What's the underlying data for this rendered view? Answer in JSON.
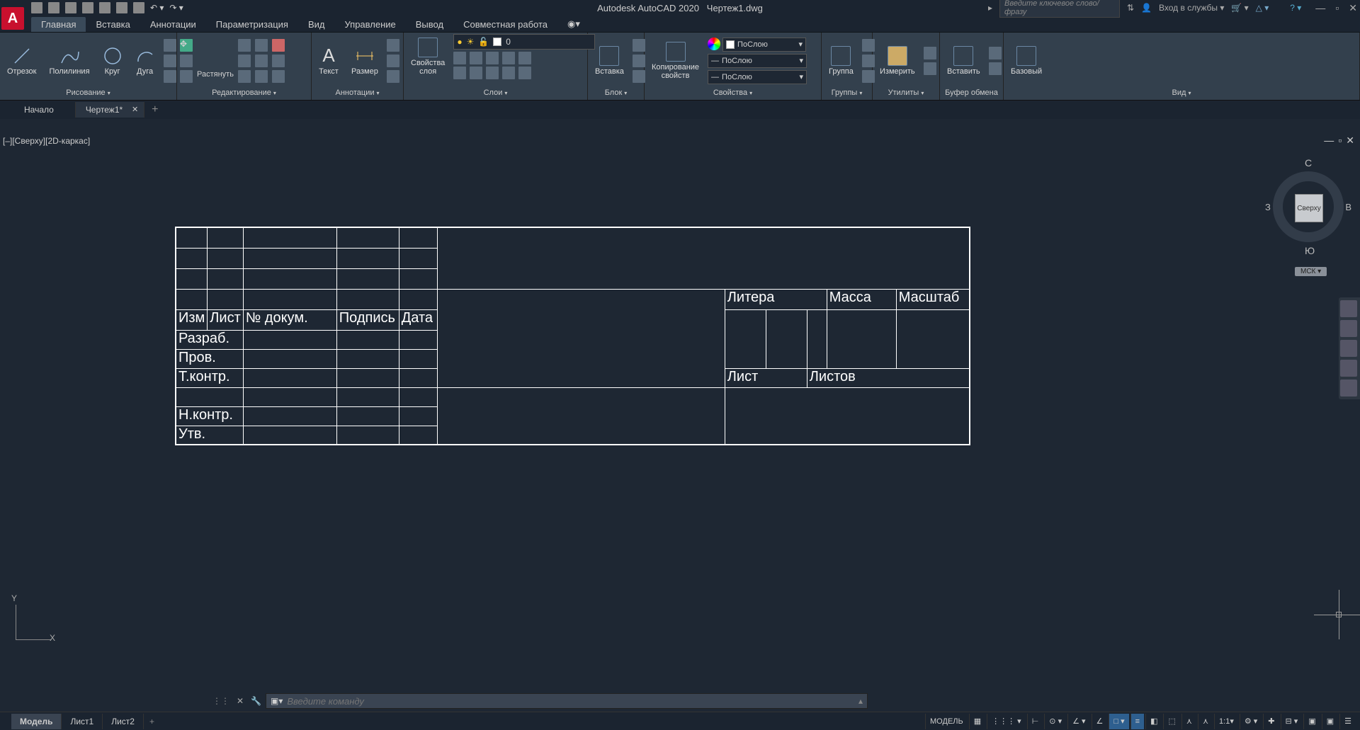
{
  "app": {
    "logo": "A",
    "title": "Autodesk AutoCAD 2020",
    "filename": "Чертеж1.dwg"
  },
  "search": {
    "placeholder": "Введите ключевое слово/фразу"
  },
  "account": {
    "login": "Вход в службы"
  },
  "menu": {
    "tabs": [
      "Главная",
      "Вставка",
      "Аннотации",
      "Параметризация",
      "Вид",
      "Управление",
      "Вывод",
      "Совместная работа"
    ],
    "active": 0
  },
  "ribbon": {
    "draw": {
      "title": "Рисование",
      "line": "Отрезок",
      "polyline": "Полилиния",
      "circle": "Круг",
      "arc": "Дуга"
    },
    "modify": {
      "title": "Редактирование",
      "stretch": "Растянуть"
    },
    "annot": {
      "title": "Аннотации",
      "text": "Текст",
      "dim": "Размер"
    },
    "layers": {
      "title": "Слои",
      "props": "Свойства\nслоя",
      "current": "0"
    },
    "block": {
      "title": "Блок",
      "insert": "Вставка"
    },
    "props": {
      "title": "Свойства",
      "match": "Копирование\nсвойств",
      "bylayer": "ПоСлою"
    },
    "groups": {
      "title": "Группы",
      "group": "Группа"
    },
    "utils": {
      "title": "Утилиты",
      "measure": "Измерить"
    },
    "clip": {
      "title": "Буфер обмена",
      "paste": "Вставить"
    },
    "view": {
      "title": "Вид",
      "base": "Базовый"
    }
  },
  "filetabs": {
    "start": "Начало",
    "current": "Чертеж1*"
  },
  "viewport": {
    "label": "[–][Сверху][2D-каркас]"
  },
  "viewcube": {
    "top": "Сверху",
    "n": "С",
    "s": "Ю",
    "w": "З",
    "e": "В",
    "wcs": "МСК"
  },
  "titleblock": {
    "izm": "Изм",
    "list": "Лист",
    "docnum": "№ докум.",
    "sign": "Подпись",
    "date": "Дата",
    "razrab": "Разраб.",
    "prov": "Пров.",
    "tkontr": "Т.контр.",
    "nkontr": "Н.контр.",
    "utv": "Утв.",
    "litera": "Литера",
    "massa": "Масса",
    "mashtab": "Масштаб",
    "list2": "Лист",
    "listov": "Листов"
  },
  "ucs": {
    "y": "Y",
    "x": "X"
  },
  "cmd": {
    "placeholder": "Введите команду"
  },
  "layouts": {
    "model": "Модель",
    "l1": "Лист1",
    "l2": "Лист2"
  },
  "status": {
    "model": "МОДЕЛЬ",
    "scale": "1:1"
  }
}
